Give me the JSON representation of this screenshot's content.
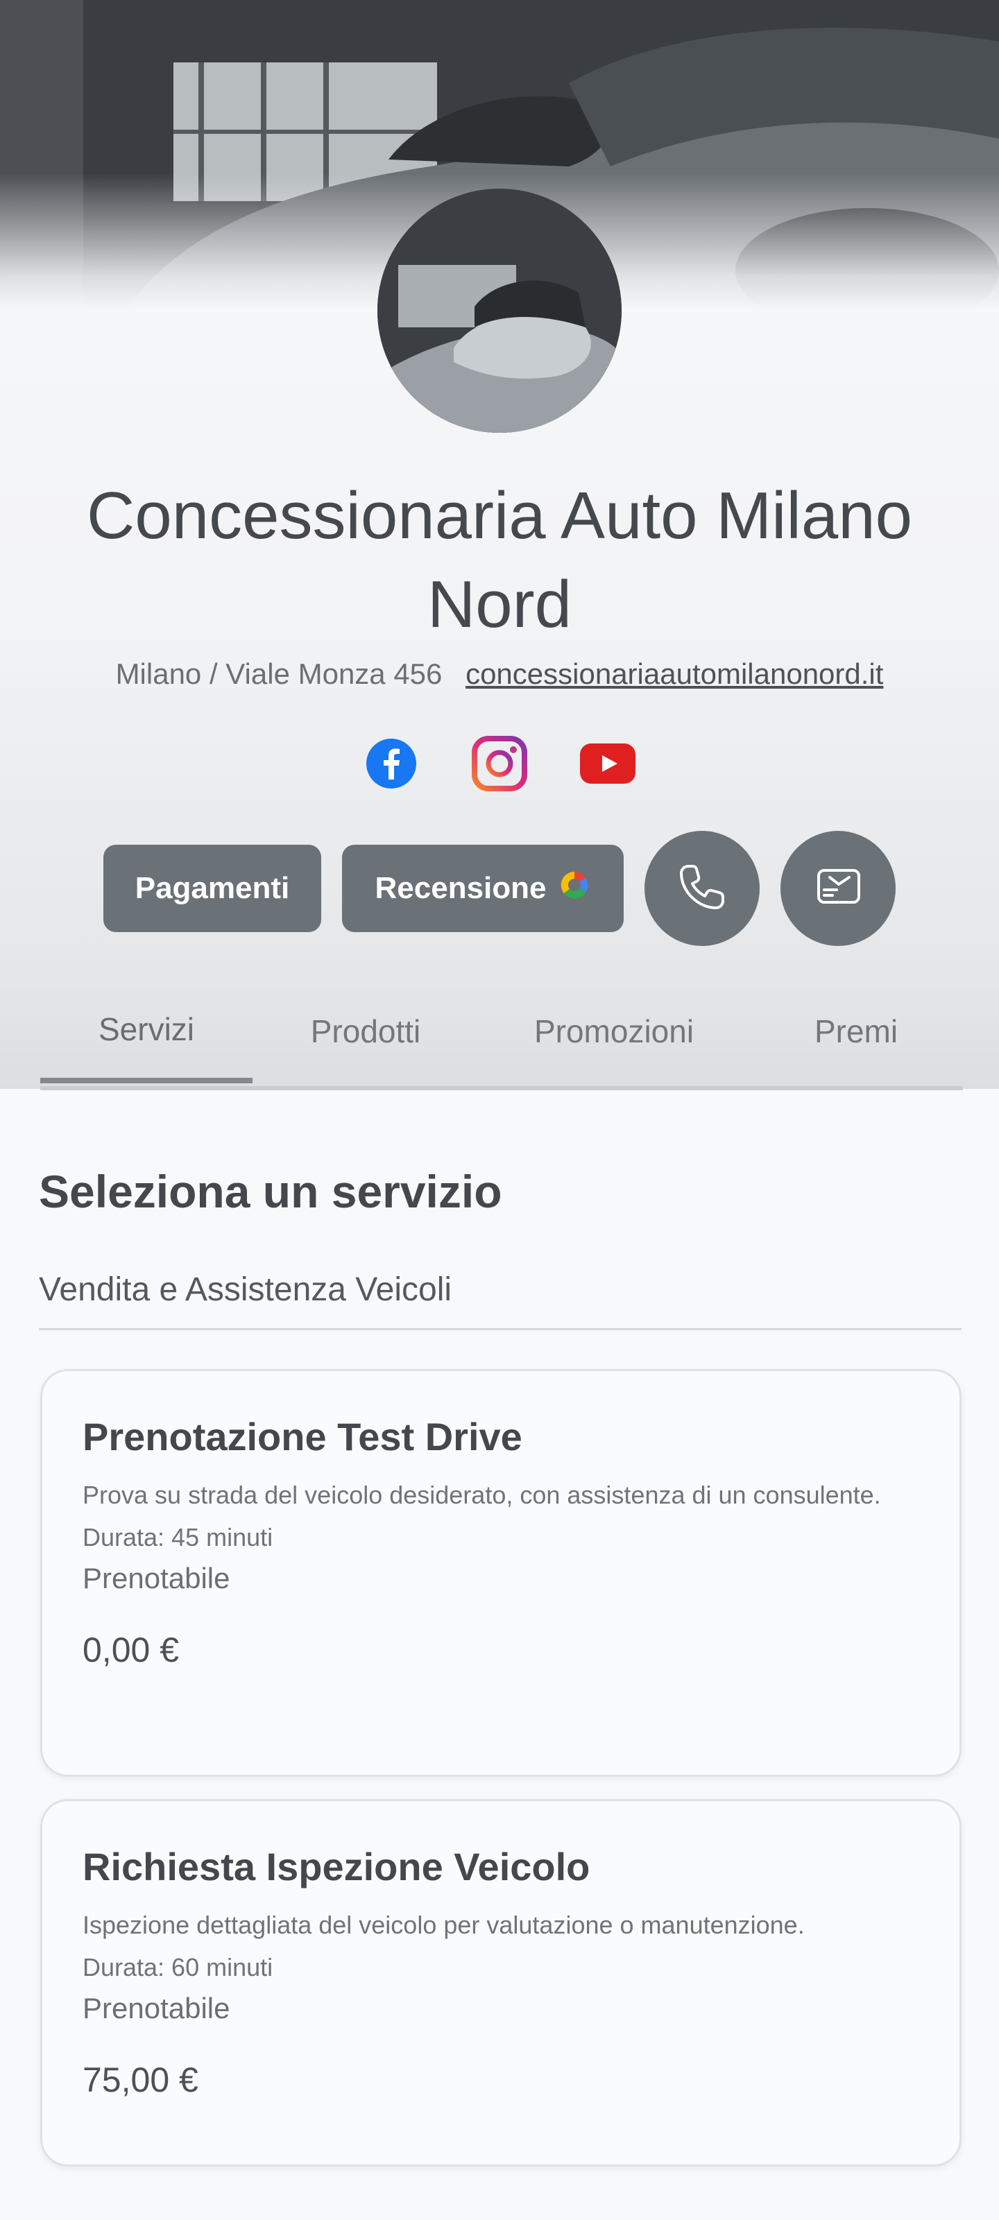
{
  "business": {
    "name": "Concessionaria Auto Milano Nord",
    "location": "Milano / Viale Monza 456",
    "website": "concessionariaautomilanonord.it"
  },
  "socials": [
    {
      "name": "facebook-icon",
      "color": "#1877F2"
    },
    {
      "name": "instagram-icon",
      "color": "#E1306C"
    },
    {
      "name": "youtube-icon",
      "color": "#E02020"
    }
  ],
  "actions": {
    "payments_label": "Pagamenti",
    "review_label": "Recensione",
    "phone_icon": "phone-icon",
    "message_icon": "message-icon"
  },
  "tabs": [
    {
      "label": "Servizi",
      "active": true
    },
    {
      "label": "Prodotti",
      "active": false
    },
    {
      "label": "Promozioni",
      "active": false
    },
    {
      "label": "Premi",
      "active": false
    }
  ],
  "services": {
    "heading": "Seleziona un servizio",
    "category": "Vendita e Assistenza Veicoli",
    "items": [
      {
        "title": "Prenotazione Test Drive",
        "description": "Prova su strada del veicolo desiderato, con assistenza di un consulente.",
        "duration": "Durata: 45 minuti",
        "bookable": "Prenotabile",
        "price": "0,00 €"
      },
      {
        "title": "Richiesta Ispezione Veicolo",
        "description": "Ispezione dettagliata del veicolo per valutazione o manutenzione.",
        "duration": "Durata: 60 minuti",
        "bookable": "Prenotabile",
        "price": "75,00 €"
      }
    ]
  },
  "colors": {
    "button_bg": "#6a7177",
    "text_dark": "#44484d",
    "background": "#f8f9fb"
  }
}
